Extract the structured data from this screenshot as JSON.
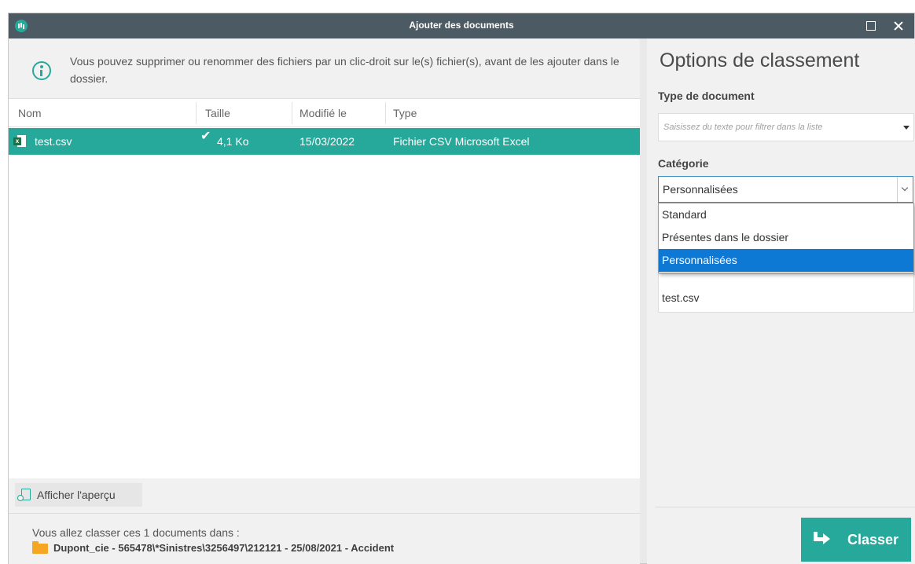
{
  "window": {
    "title": "Ajouter des documents",
    "accent": "#26a99a",
    "titlebar_color": "#4c5b63"
  },
  "info": {
    "text": "Vous pouvez supprimer ou renommer des fichiers par un clic-droit sur le(s) fichier(s), avant de les ajouter dans le dossier.",
    "icon": "info-icon"
  },
  "table": {
    "columns": [
      "Nom",
      "Taille",
      "Modifié le",
      "Type"
    ],
    "rows": [
      {
        "name": "test.csv",
        "icon": "excel-file-icon",
        "size": "4,1 Ko",
        "status_icon": "check-icon",
        "modified": "15/03/2022",
        "type": "Fichier CSV Microsoft Excel",
        "selected": true
      }
    ]
  },
  "preview_button": {
    "label": "Afficher l'aperçu",
    "icon": "preview-icon"
  },
  "footer": {
    "line1": "Vous allez classer ces 1 documents dans :",
    "path": "Dupont_cie - 565478\\*Sinistres\\3256497\\212121 - 25/08/2021 - Accident",
    "icon": "folder-icon",
    "folder_color": "#f5a623"
  },
  "options": {
    "title": "Options de classement",
    "doc_type_label": "Type de document",
    "doc_type_placeholder": "Saisissez du texte pour filtrer dans la liste",
    "category_label": "Catégorie",
    "category_value": "Personnalisées",
    "category_options": [
      "Standard",
      "Présentes dans le dossier",
      "Personnalisées"
    ],
    "category_selected_index": 2,
    "filename_value": "test.csv",
    "selected_color": "#0e78d5"
  },
  "classer_button": {
    "label": "Classer",
    "icon": "arrow-right-icon"
  }
}
